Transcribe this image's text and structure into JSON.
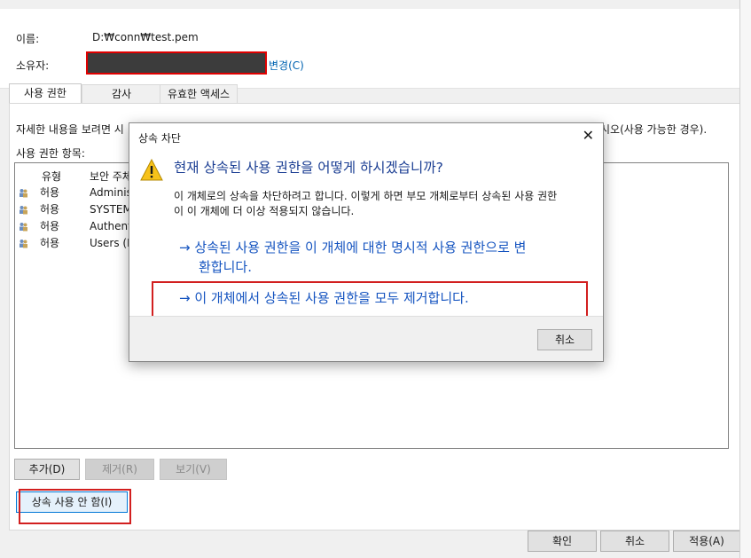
{
  "props": {
    "name_label": "이름:",
    "name_value": "D:₩conn₩test.pem",
    "owner_label": "소유자:",
    "change_label": "변경(C)"
  },
  "tabs": [
    "사용 권한",
    "감사",
    "유효한 액세스"
  ],
  "panel": {
    "info_text_left": "자세한 내용을 보려면 시",
    "info_text_right": "시오(사용 가능한 경우).",
    "entries_label": "사용 권한 항목:",
    "columns": [
      "유형",
      "보안 주체"
    ],
    "rows": [
      {
        "type": "허용",
        "principal": "Adminis"
      },
      {
        "type": "허용",
        "principal": "SYSTEM"
      },
      {
        "type": "허용",
        "principal": "Authent"
      },
      {
        "type": "허용",
        "principal": "Users (D"
      }
    ]
  },
  "buttons": {
    "add": "추가(D)",
    "remove": "제거(R)",
    "view": "보기(V)",
    "disable_inheritance": "상속 사용 안 함(I)",
    "ok": "확인",
    "cancel": "취소",
    "apply": "적용(A)"
  },
  "dialog": {
    "title": "상속 차단",
    "heading": "현재 상속된 사용 권한을 어떻게 하시겠습니까?",
    "desc_line1": "이 개체로의 상속을 차단하려고 합니다. 이렇게 하면 부모 개체로부터 상속된 사용 권한",
    "desc_line2": "이 이 개체에 더 이상 적용되지 않습니다.",
    "option1_line1": "→ 상속된 사용 권한을 이 개체에 대한 명시적 사용 권한으로 변",
    "option1_line2": "환합니다.",
    "option2": "→ 이 개체에서 상속된 사용 권한을 모두 제거합니다.",
    "cancel": "취소"
  },
  "colors": {
    "accent_link": "#0063b1",
    "highlight_red": "#d21f1f",
    "heading_blue": "#1b3e93"
  }
}
